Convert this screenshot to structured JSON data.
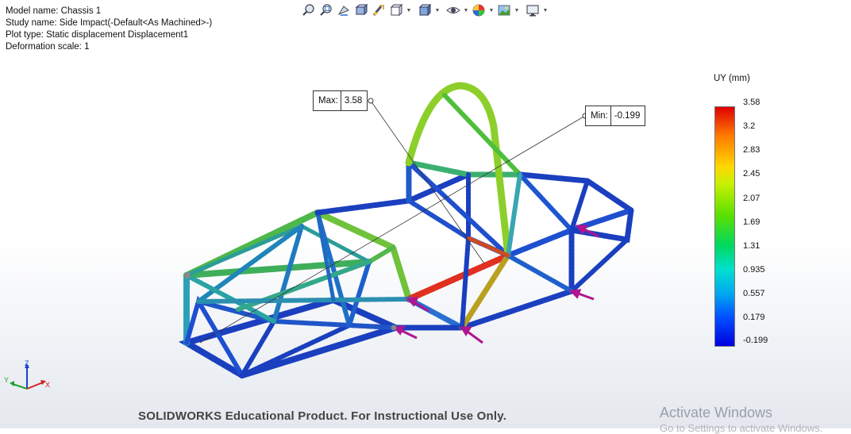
{
  "study_info": {
    "model_name": "Model name: Chassis 1",
    "study_name": "Study name: Side Impact(-Default<As Machined>-)",
    "plot_type": "Plot type: Static displacement Displacement1",
    "deformation_scale": "Deformation scale: 1"
  },
  "toolbar": {
    "buttons": [
      "zoom-to-fit-icon",
      "zoom-to-area-icon",
      "previous-view-icon",
      "section-view-icon",
      "view-settings-icon",
      "display-style-icon",
      "view-orientation-icon",
      "hide-show-icon",
      "appearance-icon",
      "scene-icon",
      "display-icon"
    ]
  },
  "callouts": {
    "max_label": "Max:",
    "max_value": "3.58",
    "min_label": "Min:",
    "min_value": "-0.199"
  },
  "legend": {
    "title": "UY (mm)",
    "ticks": [
      "3.58",
      "3.2",
      "2.83",
      "2.45",
      "2.07",
      "1.69",
      "1.31",
      "0.935",
      "0.557",
      "0.179",
      "-0.199"
    ],
    "colors": [
      "#e00000",
      "#ff7a00",
      "#ffd800",
      "#5de000",
      "#00d860",
      "#00e0d0",
      "#00a8f0",
      "#0050ff",
      "#0000e0"
    ]
  },
  "triad": {
    "x": "X",
    "y": "Y",
    "z": "Z"
  },
  "watermark": "SOLIDWORKS Educational Product. For Instructional Use Only.",
  "os_notice": {
    "title": "Activate Windows",
    "subtitle": "Go to Settings to activate Windows."
  }
}
